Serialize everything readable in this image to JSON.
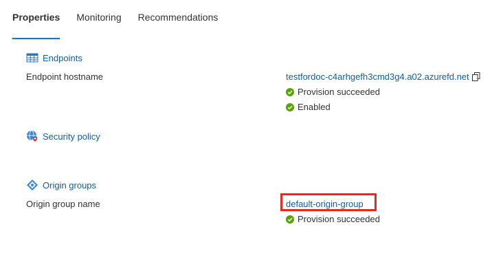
{
  "tabs": [
    {
      "label": "Properties",
      "active": true
    },
    {
      "label": "Monitoring",
      "active": false
    },
    {
      "label": "Recommendations",
      "active": false
    }
  ],
  "endpoints": {
    "section_title": "Endpoints",
    "icon": "endpoints-grid-icon",
    "row_label": "Endpoint hostname",
    "hostname": "testfordoc-c4arhgefh3cmd3g4.a02.azurefd.net",
    "copy_icon": "copy-icon",
    "statuses": [
      "Provision succeeded",
      "Enabled"
    ]
  },
  "security_policy": {
    "section_title": "Security policy",
    "icon": "security-policy-icon"
  },
  "origin_groups": {
    "section_title": "Origin groups",
    "icon": "origin-groups-icon",
    "row_label": "Origin group name",
    "group_name": "default-origin-group",
    "statuses": [
      "Provision succeeded"
    ]
  },
  "colors": {
    "accent": "#0078d4",
    "link": "#0f5f9c",
    "success": "#57a300",
    "highlight": "#e8291b"
  }
}
